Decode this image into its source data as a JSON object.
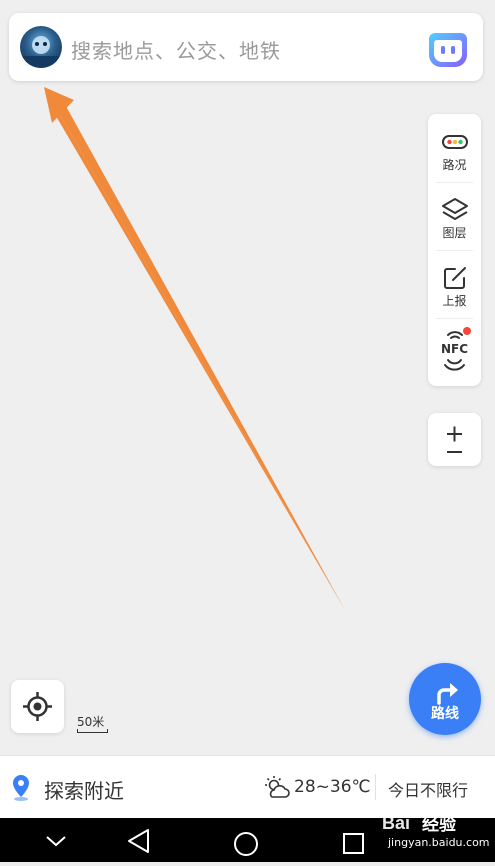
{
  "search": {
    "placeholder": "搜索地点、公交、地铁"
  },
  "tools": [
    {
      "label": "路况",
      "icon": "traffic-icon"
    },
    {
      "label": "图层",
      "icon": "layers-icon"
    },
    {
      "label": "上报",
      "icon": "report-icon"
    },
    {
      "label": "NFC",
      "icon": "nfc-icon"
    }
  ],
  "map": {
    "scale_label": "50米"
  },
  "route": {
    "label": "路线"
  },
  "bottom": {
    "nearby": "探索附近",
    "weather": "28~36℃",
    "restriction": "今日不限行"
  },
  "watermark": {
    "brand": "经验",
    "url": "jingyan.baidu.com"
  },
  "colors": {
    "accent": "#3a7ff5",
    "arrow": "#f0893a",
    "badge": "#f5483b"
  }
}
